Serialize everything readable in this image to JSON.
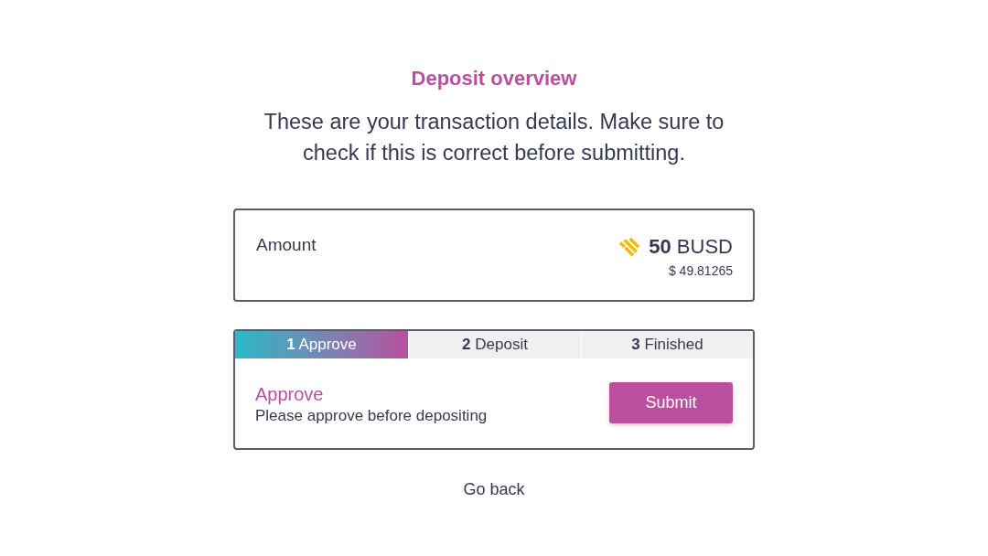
{
  "header": {
    "title": "Deposit overview",
    "description": "These are your transaction details. Make sure to check if this is correct before submitting."
  },
  "amount_card": {
    "label": "Amount",
    "value": "**50** BUSD",
    "fiat_value": "$ 49.81265"
  },
  "steps": {
    "tabs": [
      {
        "number": "1",
        "label": "Approve",
        "selected": true
      },
      {
        "number": "2",
        "label": "Deposit",
        "selected": false
      },
      {
        "number": "3",
        "label": "Finished",
        "selected": false
      }
    ],
    "panel": {
      "title": "Approve",
      "description": "Please approve before depositing",
      "button": "Submit"
    }
  },
  "go_back": "Go back"
}
